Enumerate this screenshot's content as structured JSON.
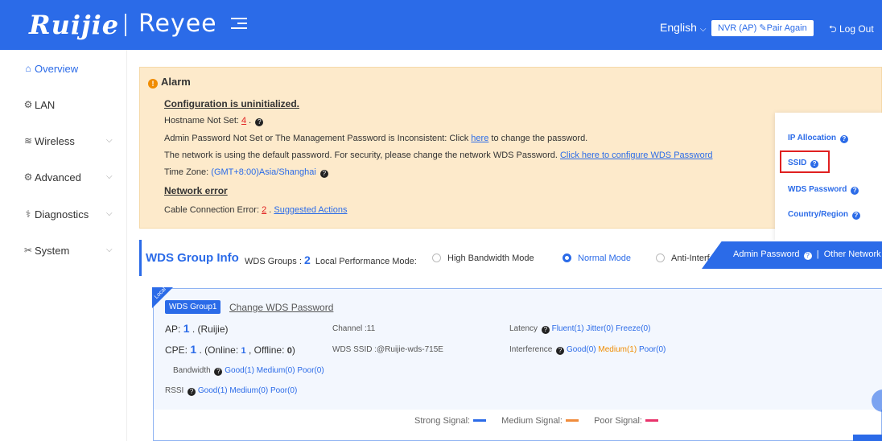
{
  "header": {
    "logo": "Ruijie",
    "brand": "Reyee",
    "language": "English",
    "device_label": "NVR (AP)",
    "pair_again": "Pair Again",
    "logout": "Log Out"
  },
  "sidebar": {
    "items": [
      {
        "label": "Overview"
      },
      {
        "label": "LAN"
      },
      {
        "label": "Wireless"
      },
      {
        "label": "Advanced"
      },
      {
        "label": "Diagnostics"
      },
      {
        "label": "System"
      }
    ]
  },
  "alarm": {
    "title": "Alarm",
    "config_heading": "Configuration is uninitialized.",
    "hostname_prefix": "Hostname Not Set: ",
    "hostname_count": "4",
    "hostname_suffix": " .",
    "admin_pw_text": "Admin Password Not Set or The Management Password is Inconsistent: Click ",
    "admin_pw_link": "here",
    "admin_pw_suffix": " to change the password.",
    "wds_text": "The network is using the default password. For security, please change the network WDS Password. ",
    "wds_link": "Click here to configure WDS Password",
    "timezone_prefix": "Time Zone: ",
    "timezone_value": "(GMT+8:00)Asia/Shanghai",
    "network_heading": "Network error",
    "cable_prefix": "Cable Connection Error: ",
    "cable_count": "2",
    "cable_mid": " . ",
    "cable_link": "Suggested Actions"
  },
  "popover": {
    "ip_allocation": "IP Allocation",
    "ssid": "SSID",
    "wds_password": "WDS Password",
    "country_region": "Country/Region"
  },
  "wds_bar": {
    "title": "WDS Group Info",
    "groups_label": "WDS Groups : ",
    "groups_count": "2",
    "mode_label": "Local Performance Mode:",
    "mode_high": "High Bandwidth Mode",
    "mode_normal": "Normal Mode",
    "mode_anti": "Anti-Interf",
    "admin_password": "Admin Password",
    "other_network": "Other Network"
  },
  "group": {
    "local_tag": "Local",
    "name": "WDS Group1",
    "change_pw": "Change WDS Password",
    "ap_label": "AP: ",
    "ap_count": "1",
    "ap_suffix": " . (Ruijie)",
    "channel": "Channel :11",
    "latency_label": "Latency",
    "latency_fluent": "Fluent(1)",
    "latency_jitter": "Jitter(0)",
    "latency_freeze": "Freeze(0)",
    "cpe_label": "CPE: ",
    "cpe_count": "1",
    "cpe_online_label": " . (Online: ",
    "cpe_online": "1",
    "cpe_offline_label": " , Offline: ",
    "cpe_offline": "0",
    "cpe_end": ")",
    "wds_ssid": "WDS SSID :@Ruijie-wds-715E",
    "interference_label": "Interference",
    "int_good": "Good(0)",
    "int_medium": "Medium(1)",
    "int_poor": "Poor(0)",
    "bandwidth_label": "Bandwidth",
    "bw_good": "Good(1)",
    "bw_medium": "Medium(0)",
    "bw_poor": "Poor(0)",
    "rssi_label": "RSSI",
    "rssi_good": "Good(1)",
    "rssi_medium": "Medium(0)",
    "rssi_poor": "Poor(0)"
  },
  "legend": {
    "strong": "Strong Signal:",
    "medium": "Medium Signal:",
    "poor": "Poor Signal:",
    "strong_color": "#2b6be8",
    "medium_color": "#f08c3c",
    "poor_color": "#e8336b"
  }
}
